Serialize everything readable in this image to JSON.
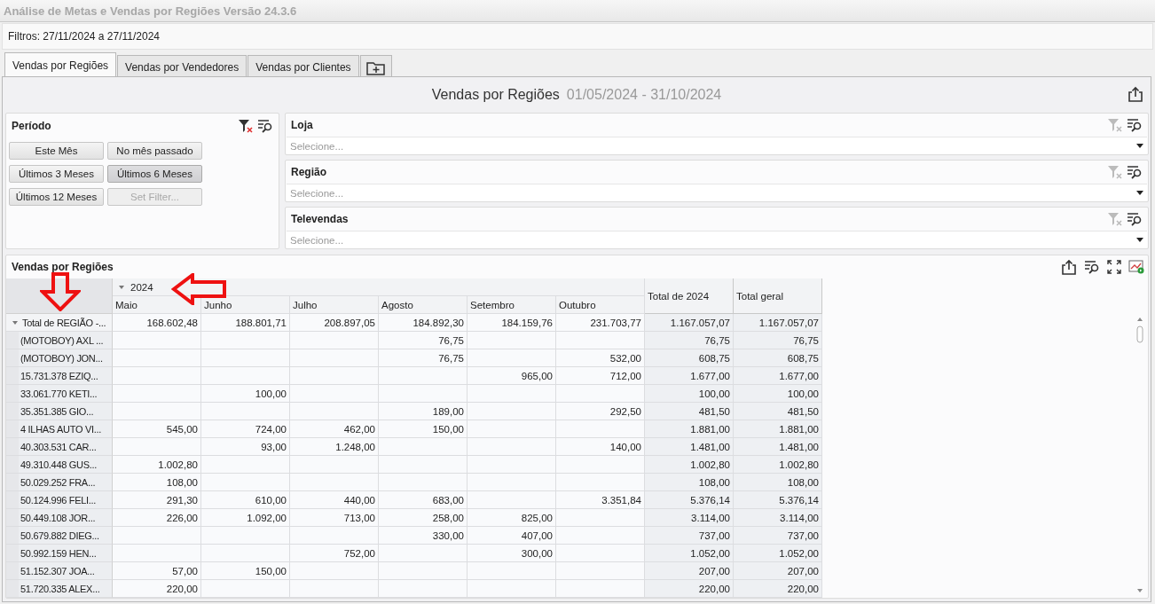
{
  "window": {
    "title": "Análise de Metas e Vendas por Regiões Versão 24.3.6"
  },
  "filter_bar": {
    "text": "Filtros: 27/11/2024 a 27/11/2024"
  },
  "tabs": [
    {
      "label": "Vendas por Regiões",
      "selected": true
    },
    {
      "label": "Vendas por Vendedores",
      "selected": false
    },
    {
      "label": "Vendas por Clientes",
      "selected": false
    }
  ],
  "dashboard": {
    "title": "Vendas por Regiões",
    "date_range": "01/05/2024 - 31/10/2024"
  },
  "period_filter": {
    "title": "Período",
    "clear_enabled": true,
    "buttons": [
      {
        "label": "Este Mês",
        "selected": false,
        "disabled": false
      },
      {
        "label": "No mês passado",
        "selected": false,
        "disabled": false
      },
      {
        "label": "Últimos 3 Meses",
        "selected": false,
        "disabled": false
      },
      {
        "label": "Últimos 6 Meses",
        "selected": true,
        "disabled": false
      },
      {
        "label": "Últimos 12 Meses",
        "selected": false,
        "disabled": false
      },
      {
        "label": "Set Filter...",
        "selected": false,
        "disabled": true
      }
    ]
  },
  "combo_filters": [
    {
      "title": "Loja",
      "placeholder": "Selecione...",
      "clear_enabled": false
    },
    {
      "title": "Região",
      "placeholder": "Selecione...",
      "clear_enabled": false
    },
    {
      "title": "Televendas",
      "placeholder": "Selecione...",
      "clear_enabled": false
    }
  ],
  "pivot": {
    "title": "Vendas por Regiões",
    "year": "2024",
    "year_expanded": true,
    "columns": [
      "Maio",
      "Junho",
      "Julho",
      "Agosto",
      "Setembro",
      "Outubro"
    ],
    "total_columns": [
      "Total de 2024",
      "Total geral"
    ],
    "total_row": {
      "label": "Total de REGIÃO -...",
      "expanded": true,
      "cells": [
        "168.602,48",
        "188.801,71",
        "208.897,05",
        "184.892,30",
        "184.159,76",
        "231.703,77",
        "1.167.057,07",
        "1.167.057,07"
      ]
    },
    "rows": [
      {
        "label": "(MOTOBOY) AXL ...",
        "cells": [
          null,
          null,
          null,
          "76,75",
          null,
          null,
          "76,75",
          "76,75"
        ]
      },
      {
        "label": "(MOTOBOY) JON...",
        "cells": [
          null,
          null,
          null,
          "76,75",
          null,
          "532,00",
          "608,75",
          "608,75"
        ]
      },
      {
        "label": "15.731.378 EZIQ...",
        "cells": [
          null,
          null,
          null,
          null,
          "965,00",
          "712,00",
          "1.677,00",
          "1.677,00"
        ]
      },
      {
        "label": "33.061.770 KETI...",
        "cells": [
          null,
          "100,00",
          null,
          null,
          null,
          null,
          "100,00",
          "100,00"
        ]
      },
      {
        "label": "35.351.385 GIO...",
        "cells": [
          null,
          null,
          null,
          "189,00",
          null,
          "292,50",
          "481,50",
          "481,50"
        ]
      },
      {
        "label": "4 ILHAS AUTO VI...",
        "cells": [
          "545,00",
          "724,00",
          "462,00",
          "150,00",
          null,
          null,
          "1.881,00",
          "1.881,00"
        ]
      },
      {
        "label": "40.303.531 CAR...",
        "cells": [
          null,
          "93,00",
          "1.248,00",
          null,
          null,
          "140,00",
          "1.481,00",
          "1.481,00"
        ]
      },
      {
        "label": "49.310.448 GUS...",
        "cells": [
          "1.002,80",
          null,
          null,
          null,
          null,
          null,
          "1.002,80",
          "1.002,80"
        ]
      },
      {
        "label": "50.029.252 FRA...",
        "cells": [
          "108,00",
          null,
          null,
          null,
          null,
          null,
          "108,00",
          "108,00"
        ]
      },
      {
        "label": "50.124.996 FELI...",
        "cells": [
          "291,30",
          "610,00",
          "440,00",
          "683,00",
          null,
          "3.351,84",
          "5.376,14",
          "5.376,14"
        ]
      },
      {
        "label": "50.449.108 JOR...",
        "cells": [
          "226,00",
          "1.092,00",
          "713,00",
          "258,00",
          "825,00",
          null,
          "3.114,00",
          "3.114,00"
        ]
      },
      {
        "label": "50.679.882 DIEG...",
        "cells": [
          null,
          null,
          null,
          "330,00",
          "407,00",
          null,
          "737,00",
          "737,00"
        ]
      },
      {
        "label": "50.992.159 HEN...",
        "cells": [
          null,
          null,
          "752,00",
          null,
          "300,00",
          null,
          "1.052,00",
          "1.052,00"
        ]
      },
      {
        "label": "51.152.307 JOA...",
        "cells": [
          "57,00",
          "150,00",
          null,
          null,
          null,
          null,
          "207,00",
          "207,00"
        ]
      },
      {
        "label": "51.720.335 ALEX...",
        "cells": [
          "220,00",
          null,
          null,
          null,
          null,
          null,
          "220,00",
          "220,00"
        ]
      }
    ]
  }
}
